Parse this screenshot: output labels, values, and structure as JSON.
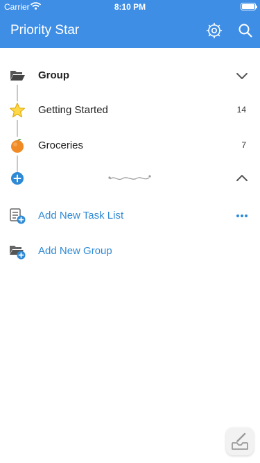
{
  "status_bar": {
    "carrier": "Carrier",
    "time": "8:10 PM"
  },
  "header": {
    "title": "Priority Star",
    "background_color": "#3e8ee6",
    "buttons": [
      {
        "icon": "gear-icon"
      },
      {
        "icon": "search-icon"
      }
    ]
  },
  "group": {
    "icon": "open-folder-icon",
    "title": "Group",
    "expanded": true,
    "lists": [
      {
        "icon": "star-icon",
        "label": "Getting Started",
        "count": "14"
      },
      {
        "icon": "orange-icon",
        "label": "Groceries",
        "count": "7"
      }
    ]
  },
  "actions": {
    "add_task_list": "Add New Task List",
    "add_group": "Add New Group"
  },
  "accent_color": "#2f8ad5"
}
